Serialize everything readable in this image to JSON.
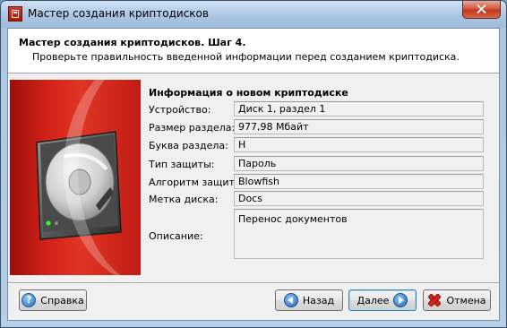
{
  "window": {
    "title": "Мастер создания криптодисков"
  },
  "header": {
    "title": "Мастер создания криптодисков. Шаг 4.",
    "subtitle": "Проверьте правильность введенной информации перед созданием криптодиска."
  },
  "info": {
    "title": "Информация о новом криптодиске",
    "rows": [
      {
        "label": "Устройство:",
        "value": "Диск 1, раздел 1"
      },
      {
        "label": "Размер раздела:",
        "value": "977,98 Мбайт"
      },
      {
        "label": "Буква раздела:",
        "value": "H"
      },
      {
        "label": "Тип защиты:",
        "value": "Пароль"
      },
      {
        "label": "Алгоритм защиты:",
        "value": "Blowfish"
      },
      {
        "label": "Метка диска:",
        "value": "Docs"
      },
      {
        "label": "Описание:",
        "value": "Перенос документов"
      }
    ]
  },
  "buttons": {
    "help": "Справка",
    "back": "Назад",
    "next": "Далее",
    "cancel": "Отмена"
  },
  "icons": {
    "app": "app-shield-icon",
    "close": "close-icon",
    "disk": "hard-disk-icon",
    "help": "question-icon",
    "back": "arrow-left-icon",
    "next": "arrow-right-icon",
    "cancel": "x-icon"
  },
  "colors": {
    "banner_red": "#d4231a",
    "title_bar": "#a8c3e0",
    "close_button": "#c2351c"
  }
}
